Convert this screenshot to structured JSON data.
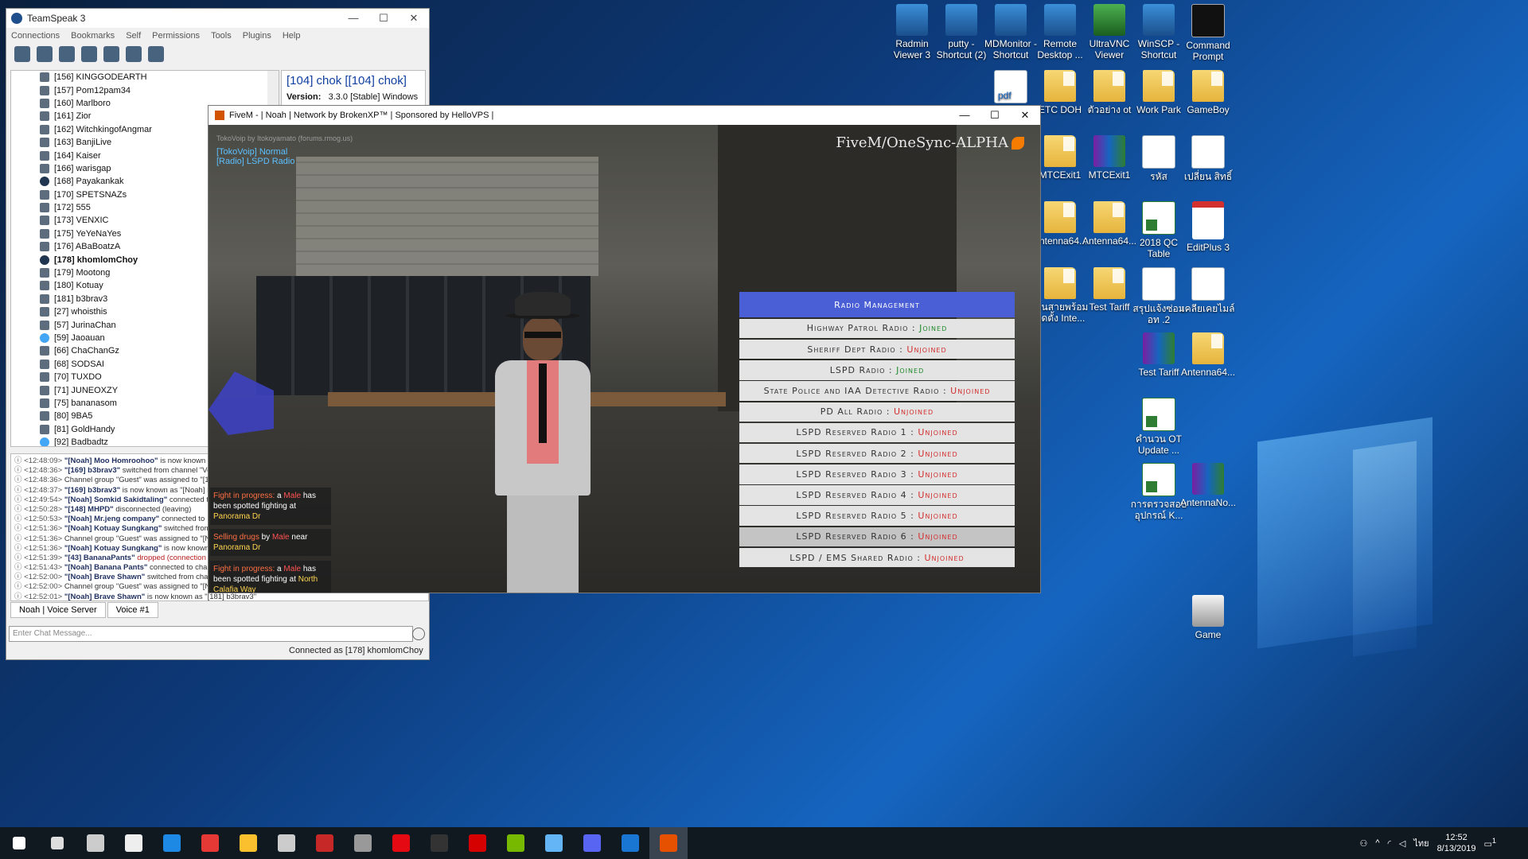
{
  "desktop": {
    "icons": [
      {
        "label": "Radmin Viewer 3",
        "icon": "radmin-icon"
      },
      {
        "label": "putty - Shortcut (2)",
        "icon": "putty-icon"
      },
      {
        "label": "MDMonitor - Shortcut",
        "icon": "mdmonitor-icon"
      },
      {
        "label": "Remote Desktop ...",
        "icon": "remote-desktop-icon"
      },
      {
        "label": "UltraVNC Viewer",
        "icon": "ultravnc-icon"
      },
      {
        "label": "WinSCP - Shortcut",
        "icon": "winscp-icon"
      },
      {
        "label": "Command Prompt",
        "icon": "cmd-icon"
      },
      {
        "label": "",
        "icon": "pdf-icon"
      },
      {
        "label": "ETC DOH",
        "icon": "folder-icon"
      },
      {
        "label": "ตัวอย่าง ot",
        "icon": "folder-icon"
      },
      {
        "label": "Work Park",
        "icon": "folder-icon"
      },
      {
        "label": "GameBoy",
        "icon": "folder-icon"
      },
      {
        "label": "MTCExit1",
        "icon": "folder-icon"
      },
      {
        "label": "MTCExit1",
        "icon": "winrar-icon"
      },
      {
        "label": "รหัส",
        "icon": "document-icon"
      },
      {
        "label": "เปลี่ยน สิทธิ์",
        "icon": "document-icon"
      },
      {
        "label": "Antenna64...",
        "icon": "folder-icon"
      },
      {
        "label": "Antenna64...",
        "icon": "folder-icon"
      },
      {
        "label": "2018 QC Table",
        "icon": "excel-icon"
      },
      {
        "label": "EditPlus 3",
        "icon": "editplus-icon"
      },
      {
        "label": "เดินสายพร้อม ติดตั้ง Inte...",
        "icon": "folder-icon"
      },
      {
        "label": "Test Tariff",
        "icon": "folder-icon"
      },
      {
        "label": "สรุปแจ้งซ่อม อท .2",
        "icon": "document-icon"
      },
      {
        "label": "เคลียเคยไมล์",
        "icon": "document-icon"
      },
      {
        "label": "Test Tariff",
        "icon": "winrar-icon"
      },
      {
        "label": "Antenna64...",
        "icon": "folder-icon"
      },
      {
        "label": "คำนวน OT Update ...",
        "icon": "excel-icon"
      },
      {
        "label": "การตรวจสอบ อุปกรณ์ K...",
        "icon": "excel-icon"
      },
      {
        "label": "AntennaNo...",
        "icon": "winrar-icon"
      },
      {
        "label": "Game",
        "icon": "game-icon"
      }
    ]
  },
  "teamspeak": {
    "title": "TeamSpeak 3",
    "menu": [
      "Connections",
      "Bookmarks",
      "Self",
      "Permissions",
      "Tools",
      "Plugins",
      "Help"
    ],
    "users": [
      {
        "name": "[156] KINGGODEARTH",
        "type": "user"
      },
      {
        "name": "[157] Pom12pam34",
        "type": "user"
      },
      {
        "name": "[160] Marlboro",
        "type": "user"
      },
      {
        "name": "[161] Zior",
        "type": "user"
      },
      {
        "name": "[162] WitchkingofAngmar",
        "type": "user"
      },
      {
        "name": "[163] BanjiLive",
        "type": "user"
      },
      {
        "name": "[164] Kaiser",
        "type": "user"
      },
      {
        "name": "[166] warisgap",
        "type": "user"
      },
      {
        "name": "[168] Payakankak",
        "type": "ball"
      },
      {
        "name": "[170] SPETSNAZs",
        "type": "user"
      },
      {
        "name": "[172] 555",
        "type": "user"
      },
      {
        "name": "[173] VENXIC",
        "type": "user"
      },
      {
        "name": "[175] YeYeNaYes",
        "type": "user"
      },
      {
        "name": "[176] ABaBoatzA",
        "type": "user"
      },
      {
        "name": "[178] khomlomChoy",
        "type": "ball",
        "bold": true
      },
      {
        "name": "[179] Mootong",
        "type": "user"
      },
      {
        "name": "[180] Kotuay",
        "type": "user"
      },
      {
        "name": "[181] b3brav3",
        "type": "user"
      },
      {
        "name": "[27] whoisthis",
        "type": "user"
      },
      {
        "name": "[57] JurinaChan",
        "type": "user"
      },
      {
        "name": "[59] Jaoauan",
        "type": "blue"
      },
      {
        "name": "[66] ChaChanGz",
        "type": "user"
      },
      {
        "name": "[68] SODSAI",
        "type": "user"
      },
      {
        "name": "[70] TUXDO",
        "type": "user"
      },
      {
        "name": "[71] JUNEOXZY",
        "type": "user"
      },
      {
        "name": "[75] bananasom",
        "type": "user"
      },
      {
        "name": "[80] 9BA5",
        "type": "user"
      },
      {
        "name": "[81] GoldHandy",
        "type": "user"
      },
      {
        "name": "[92] Badbadtz",
        "type": "blue"
      }
    ],
    "info_name": "[104] chok [[104] chok]",
    "info_version_label": "Version:",
    "info_version_value": "3.3.0 [Stable] Windows",
    "log": [
      {
        "time": "<12:48:09>",
        "bold": "\"[Noah] Moo Homroohoo\"",
        "rest": " is now known as"
      },
      {
        "time": "<12:48:36>",
        "bold": "\"[169] b3brav3\"",
        "rest": " switched from channel \"Vo"
      },
      {
        "time": "<12:48:36>",
        "bold": "",
        "rest": "Channel group \"Guest\" was assigned to \"[169]"
      },
      {
        "time": "<12:48:37>",
        "bold": "\"[169] b3brav3\"",
        "rest": " is now known as \"[Noah] B"
      },
      {
        "time": "<12:49:54>",
        "bold": "\"[Noah] Somkid Sakidtaling\"",
        "rest": " connected to"
      },
      {
        "time": "<12:50:28>",
        "bold": "\"[148] MHPD\"",
        "rest": " disconnected (leaving)"
      },
      {
        "time": "<12:50:53>",
        "bold": "\"[Noah] Mr.jeng  company\"",
        "rest": " connected to"
      },
      {
        "time": "<12:51:36>",
        "bold": "\"[Noah] Kotuay Sungkang\"",
        "rest": " switched from"
      },
      {
        "time": "<12:51:36>",
        "bold": "",
        "rest": "Channel group \"Guest\" was assigned to \"[Noa"
      },
      {
        "time": "<12:51:36>",
        "bold": "\"[Noah] Kotuay Sungkang\"",
        "rest": " is now known"
      },
      {
        "time": "<12:51:39>",
        "bold": "\"[43] BananaPants\"",
        "rest": " dropped (connection lo",
        "red": true
      },
      {
        "time": "<12:51:43>",
        "bold": "\"[Noah] Banana Pants\"",
        "rest": " connected to chann"
      },
      {
        "time": "<12:52:00>",
        "bold": "\"[Noah] Brave Shawn\"",
        "rest": " switched from chann"
      },
      {
        "time": "<12:52:00>",
        "bold": "",
        "rest": "Channel group \"Guest\" was assigned to \"[Noa"
      },
      {
        "time": "<12:52:01>",
        "bold": "\"[Noah] Brave Shawn\"",
        "rest": " is now known as \"[181] b3brav3\""
      }
    ],
    "tabs": [
      "Noah | Voice Server",
      "Voice #1"
    ],
    "chat_placeholder": "Enter Chat Message...",
    "status": "Connected as [178] khomlomChoy"
  },
  "fivem": {
    "title": "FiveM - | Noah |  Network by BrokenXP™ |  Sponsored by HelloVPS |",
    "hud_credit": "TokoVoip by Itokoyamato (forums.rmog.us)",
    "hud_voip": "[TokoVoip] Normal",
    "hud_radio": "[Radio] LSPD Radio",
    "brand": "FiveM/OneSync-ALPHA",
    "notifications": [
      {
        "a": "Fight in progress:",
        "b": " a ",
        "c": "Male",
        "d": " has been spotted fighting at ",
        "e": "Panorama Dr"
      },
      {
        "a": "Selling drugs",
        "b": " by ",
        "c": "Male",
        "d": " near ",
        "e": "Panorama Dr"
      },
      {
        "a": "Fight in progress:",
        "b": " a ",
        "c": "Male",
        "d": " has been spotted fighting at ",
        "e": "North Calafia Way"
      }
    ],
    "radio": {
      "header": "Radio Management",
      "items": [
        {
          "name": "Highway Patrol Radio",
          "status": "Joined"
        },
        {
          "name": "Sheriff Dept Radio",
          "status": "Unjoined"
        },
        {
          "name": "LSPD Radio",
          "status": "Joined"
        },
        {
          "name": "State Police and IAA Detective Radio",
          "status": "Unjoined"
        },
        {
          "name": "PD All Radio",
          "status": "Unjoined"
        },
        {
          "name": "LSPD Reserved Radio 1",
          "status": "Unjoined"
        },
        {
          "name": "LSPD Reserved Radio 2",
          "status": "Unjoined"
        },
        {
          "name": "LSPD Reserved Radio 3",
          "status": "Unjoined"
        },
        {
          "name": "LSPD Reserved Radio 4",
          "status": "Unjoined"
        },
        {
          "name": "LSPD Reserved Radio 5",
          "status": "Unjoined"
        },
        {
          "name": "LSPD Reserved Radio 6",
          "status": "Unjoined",
          "highlight": true
        },
        {
          "name": "LSPD / EMS Shared Radio",
          "status": "Unjoined"
        }
      ]
    }
  },
  "taskbar": {
    "apps": [
      "start-icon",
      "search-icon",
      "task-view-icon",
      "mail-icon",
      "edge-icon",
      "chrome-icon",
      "explorer-icon",
      "store-icon",
      "game-icon",
      "calculator-icon",
      "netflix-icon",
      "terminal-icon",
      "opera-icon",
      "nvidia-icon",
      "winscp-icon",
      "discord-icon",
      "teamspeak-icon",
      "fivem-icon"
    ],
    "lang": "ไทย",
    "time": "12:52",
    "date": "8/13/2019",
    "notif_count": "1"
  }
}
